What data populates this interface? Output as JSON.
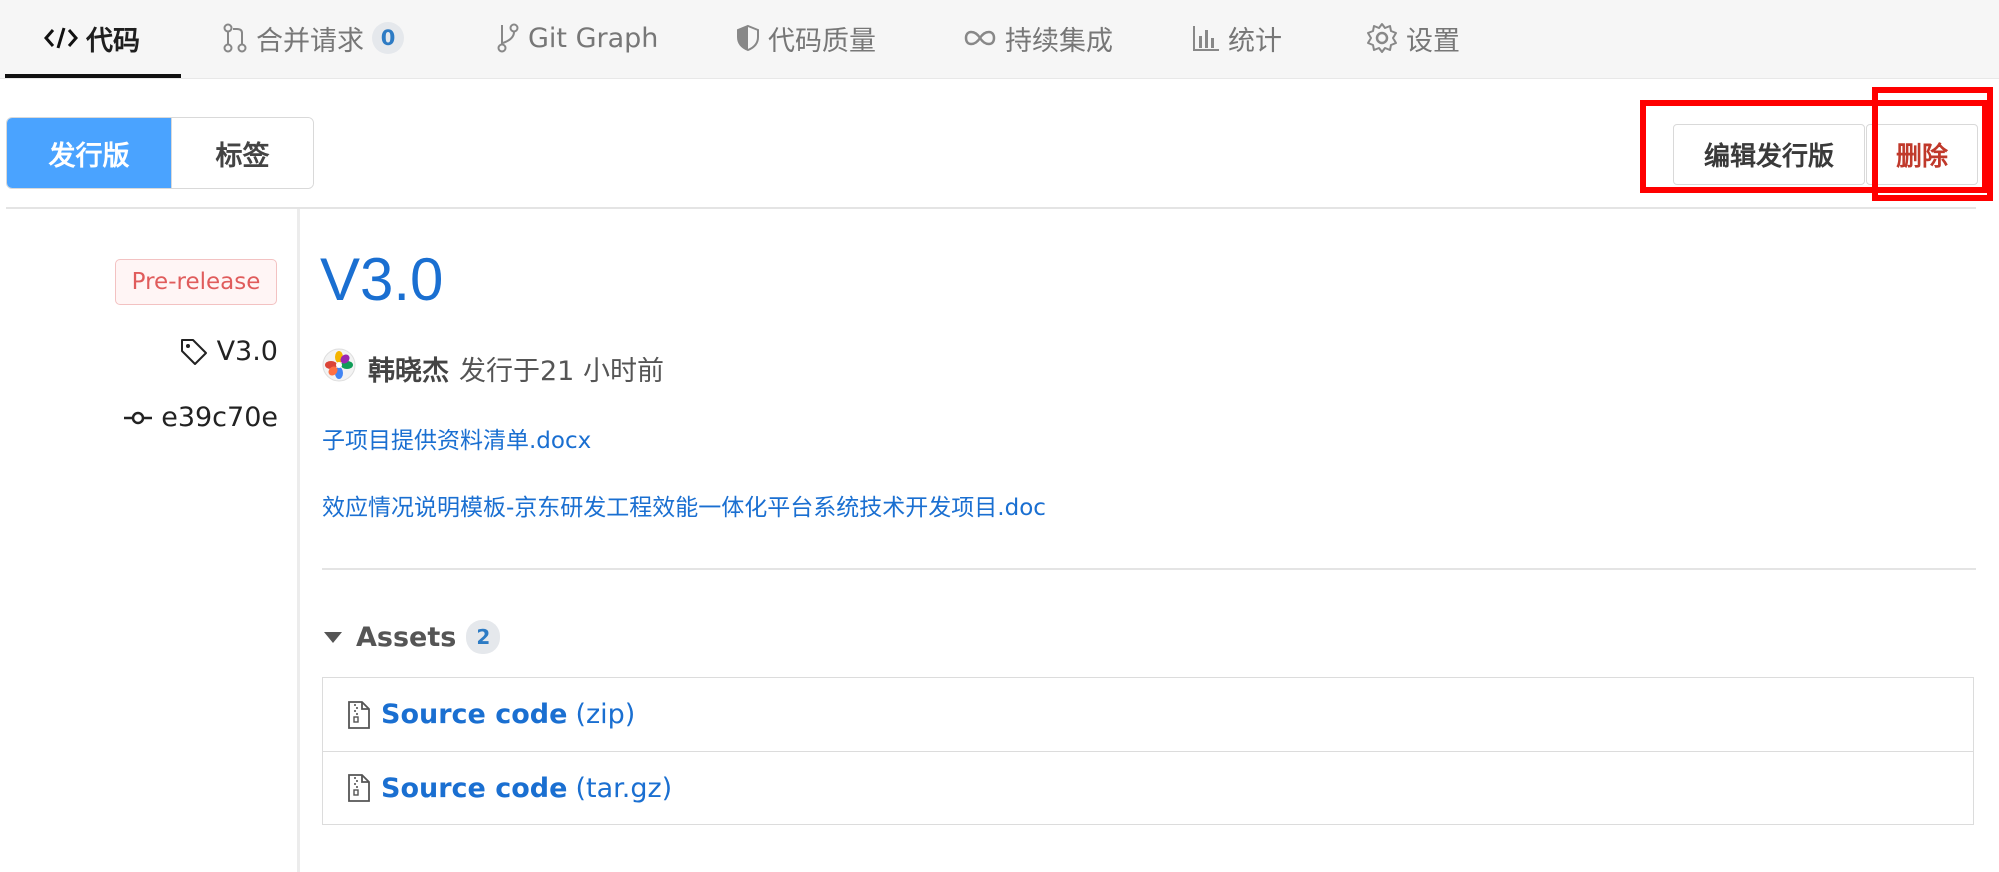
{
  "nav": {
    "tabs": [
      {
        "label": "代码",
        "icon": "code-icon",
        "active": true
      },
      {
        "label": "合并请求",
        "icon": "merge-request-icon",
        "badge": "0"
      },
      {
        "label": "Git Graph",
        "icon": "git-branch-icon"
      },
      {
        "label": "代码质量",
        "icon": "shield-icon"
      },
      {
        "label": "持续集成",
        "icon": "infinity-icon"
      },
      {
        "label": "统计",
        "icon": "bar-chart-icon"
      },
      {
        "label": "设置",
        "icon": "gear-icon"
      }
    ]
  },
  "segmented": {
    "releases_label": "发行版",
    "tags_label": "标签"
  },
  "actions": {
    "edit_label": "编辑发行版",
    "delete_label": "删除",
    "highlight_color": "#ff0000"
  },
  "release": {
    "status_badge": "Pre-release",
    "tag": "V3.0",
    "commit": "e39c70e",
    "title": "V3.0",
    "author": "韩晓杰",
    "published": "发行于21 小时前",
    "attachments": [
      "子项目提供资料清单.docx",
      "效应情况说明模板-京东研发工程效能一体化平台系统技术开发项目.doc"
    ]
  },
  "assets": {
    "heading": "Assets",
    "count": "2",
    "items": [
      {
        "name": "Source code",
        "type": "(zip)",
        "icon": "zip-file-icon"
      },
      {
        "name": "Source code",
        "type": "(tar.gz)",
        "icon": "zip-file-icon"
      }
    ]
  },
  "colors": {
    "accent": "#4aa3ff",
    "link": "#1a6fd1",
    "danger": "#c0392b",
    "prerelease": "#e05c5c"
  }
}
